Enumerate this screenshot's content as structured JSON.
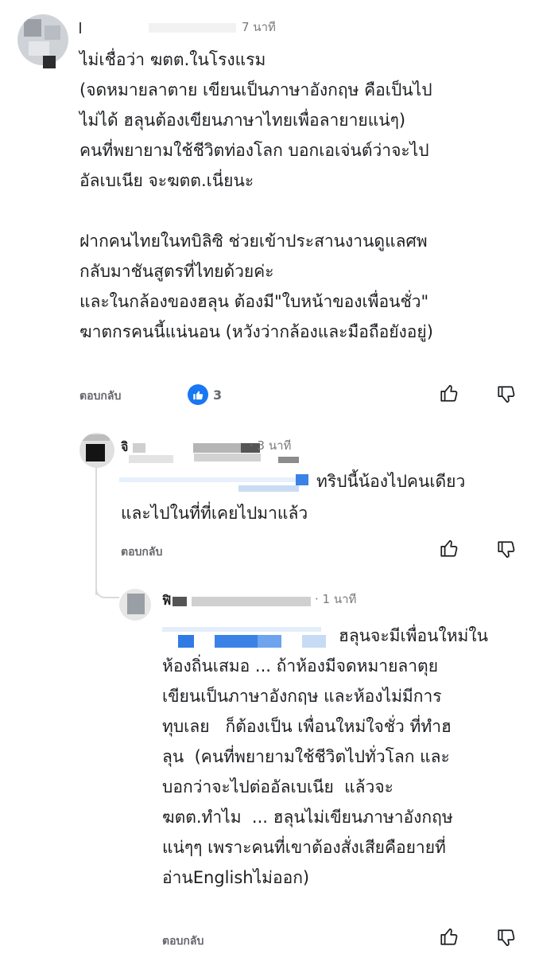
{
  "colors": {
    "link_blue": "#1877f2",
    "muted_text": "#65676b",
    "thread_line": "#d7dadf",
    "like_badge": "#1877f2"
  },
  "comment1": {
    "author": "",
    "time": "7 นาที",
    "text": "ไม่เชื่อว่า ฆตต.ในโรงแรม\n(จดหมายลาตาย เขียนเป็นภาษาอังกฤษ คือเป็นไป\nไม่ได้ ฮลุนต้องเขียนภาษาไทยเพื่อลายายแน่ๆ)\nคนที่พยายามใช้ชีวิตท่องโลก บอกเอเจ่นต์ว่าจะไป\nอัลเบเนีย จะฆตต.เนี่ยนะ\n\nฝากคนไทยในทบิลิซิ ช่วยเข้าประสานงานดูแลศพ\nกลับมาชันสูตรที่ไทยด้วยค่ะ\nและในกล้องของฮลุน ต้องมี\"ใบหน้าของเพื่อนชั่ว\"\nฆาตกรคนนี้แน่นอน (หวังว่ากล้องและมือถือยังอยู่)",
    "reply_label": "ตอบกลับ",
    "reaction_count": "3",
    "reaction_icon": "like-icon"
  },
  "reply1": {
    "author_initial": "จิ",
    "time": "· 3 นาที",
    "text_line1": "ทริปนี้น้องไปคนเดียว",
    "text_line2": "และไปในที่ที่เคยไปมาแล้ว",
    "reply_label": "ตอบกลับ"
  },
  "reply2": {
    "author_initial": "ฟิ",
    "time": "· 1 นาที",
    "text_line1": "ฮลุนจะมีเพื่อนใหม่ใน",
    "text_rest": "ห้องถิ่นเสมอ ... ถ้าห้องมีจดหมายลาตุย\nเขียนเป็นภาษาอังกฤษ และห้องไม่มีการ\nทุบเลย   ก็ต้องเป็น เพื่อนใหม่ใจชั่ว ที่ทำฮ\nลุน  (คนที่พยายามใช้ชีวิตไปทั่วโลก และ\nบอกว่าจะไปต่ออัลเบเนีย  แล้วจะ\nฆตต.ทำไม  ... ฮลุนไม่เขียนภาษาอังกฤษ\nแน่ๆๆ เพราะคนที่เขาต้องสั่งเสียคือยายที่\nอ่านEnglishไม่ออก)",
    "reply_label": "ตอบกลับ"
  }
}
